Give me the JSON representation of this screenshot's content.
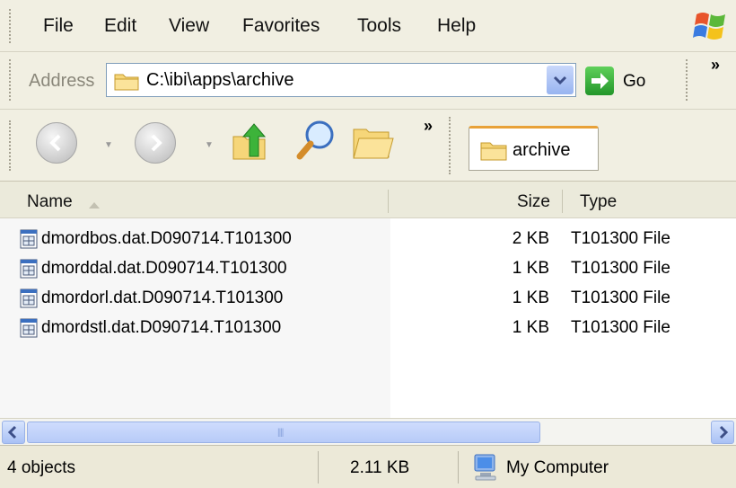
{
  "menu": {
    "items": [
      "File",
      "Edit",
      "View",
      "Favorites",
      "Tools",
      "Help"
    ]
  },
  "address": {
    "label": "Address",
    "value": "C:\\ibi\\apps\\archive",
    "go_label": "Go",
    "more": "»"
  },
  "toolbar": {
    "more": "»",
    "tab_label": "archive"
  },
  "columns": {
    "name": "Name",
    "size": "Size",
    "type": "Type"
  },
  "files": [
    {
      "name": "dmordbos.dat.D090714.T101300",
      "size": "2 KB",
      "type": "T101300 File"
    },
    {
      "name": "dmorddal.dat.D090714.T101300",
      "size": "1 KB",
      "type": "T101300 File"
    },
    {
      "name": "dmordorl.dat.D090714.T101300",
      "size": "1 KB",
      "type": "T101300 File"
    },
    {
      "name": "dmordstl.dat.D090714.T101300",
      "size": "1 KB",
      "type": "T101300 File"
    }
  ],
  "status": {
    "objects": "4 objects",
    "size": "2.11 KB",
    "zone": "My Computer"
  },
  "colors": {
    "chrome": "#ece9d8",
    "selection_accent": "#e8a138",
    "go_green": "#23962a",
    "scroll_blue": "#b7cbf8"
  }
}
